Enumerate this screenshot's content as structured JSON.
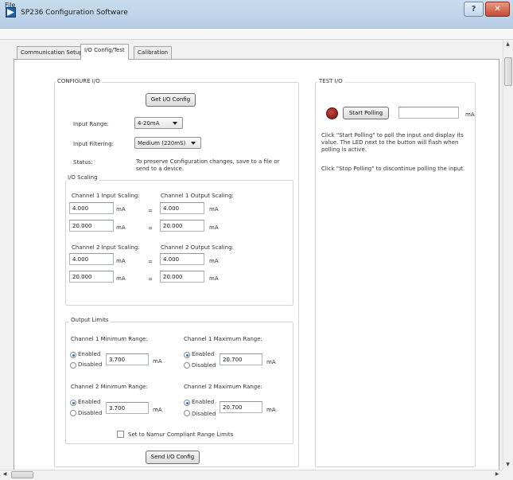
{
  "window": {
    "title": "SP236 Configuration Software"
  },
  "menu": {
    "file": "File"
  },
  "tabs": [
    {
      "label": "Communication Setup"
    },
    {
      "label": "I/O Config/Test"
    },
    {
      "label": "Calibration"
    }
  ],
  "configure": {
    "title": "CONFIGURE I/O",
    "get_button": "Get I/O Config",
    "input_range_label": "Input Range:",
    "input_range_value": "4-20mA",
    "input_filtering_label": "Input Filtering:",
    "input_filtering_value": "Medium (220mS)",
    "status_label": "Status:",
    "status_text": "To preserve Configuration changes, save to a file or send to a device.",
    "send_button": "Send I/O Config"
  },
  "scaling": {
    "title": "I/O Scaling",
    "ch1_input_label": "Channel 1 Input Scaling:",
    "ch1_output_label": "Channel 1 Output Scaling:",
    "ch2_input_label": "Channel 2 Input Scaling:",
    "ch2_output_label": "Channel 2 Output Scaling:",
    "unit": "mA",
    "equals": "=",
    "ch1_in_low": "4.000",
    "ch1_in_high": "20.000",
    "ch1_out_low": "4.000",
    "ch1_out_high": "20.000",
    "ch2_in_low": "4.000",
    "ch2_in_high": "20.000",
    "ch2_out_low": "4.000",
    "ch2_out_high": "20.000"
  },
  "limits": {
    "title": "Output Limits",
    "ch1_min_label": "Channel 1 Minimum Range:",
    "ch1_max_label": "Channel 1 Maximum Range:",
    "ch2_min_label": "Channel 2 Minimum Range:",
    "ch2_max_label": "Channel 2 Maximum Range:",
    "enabled": "Enabled",
    "disabled": "Disabled",
    "unit": "mA",
    "ch1_min_value": "3.700",
    "ch1_max_value": "20.700",
    "ch2_min_value": "3.700",
    "ch2_max_value": "20.700",
    "namur_label": "Set to Namur Compliant Range Limits"
  },
  "test": {
    "title": "TEST I/O",
    "start_button": "Start Polling",
    "reading_value": "",
    "unit": "mA",
    "help1": "Click \"Start Polling\" to poll the input and display its value. The LED next to the button will flash when polling is active.",
    "help2": "Click \"Stop Polling\" to discontinue polling the input."
  },
  "colors": {
    "led": "#9b1b14",
    "title_bar": "#c9dcef",
    "radio_selected": "#1e6fc6"
  }
}
